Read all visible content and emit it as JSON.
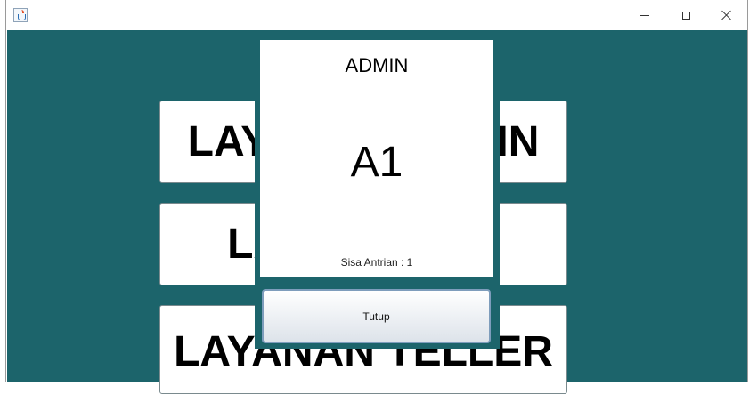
{
  "window": {
    "icon": "java-icon",
    "controls": {
      "minimize": "minimize-icon",
      "maximize": "maximize-icon",
      "close": "close-icon"
    }
  },
  "main": {
    "buttons": [
      {
        "label": "LAYANAN ADMIN"
      },
      {
        "label": "LAYANAN CS"
      },
      {
        "label": "LAYANAN TELLER"
      }
    ]
  },
  "dialog": {
    "title": "ADMIN",
    "queue_number": "A1",
    "remaining": "Sisa Antrian : 1",
    "close_label": "Tutup"
  },
  "colors": {
    "background": "#1c646b",
    "panel": "#ffffff"
  }
}
